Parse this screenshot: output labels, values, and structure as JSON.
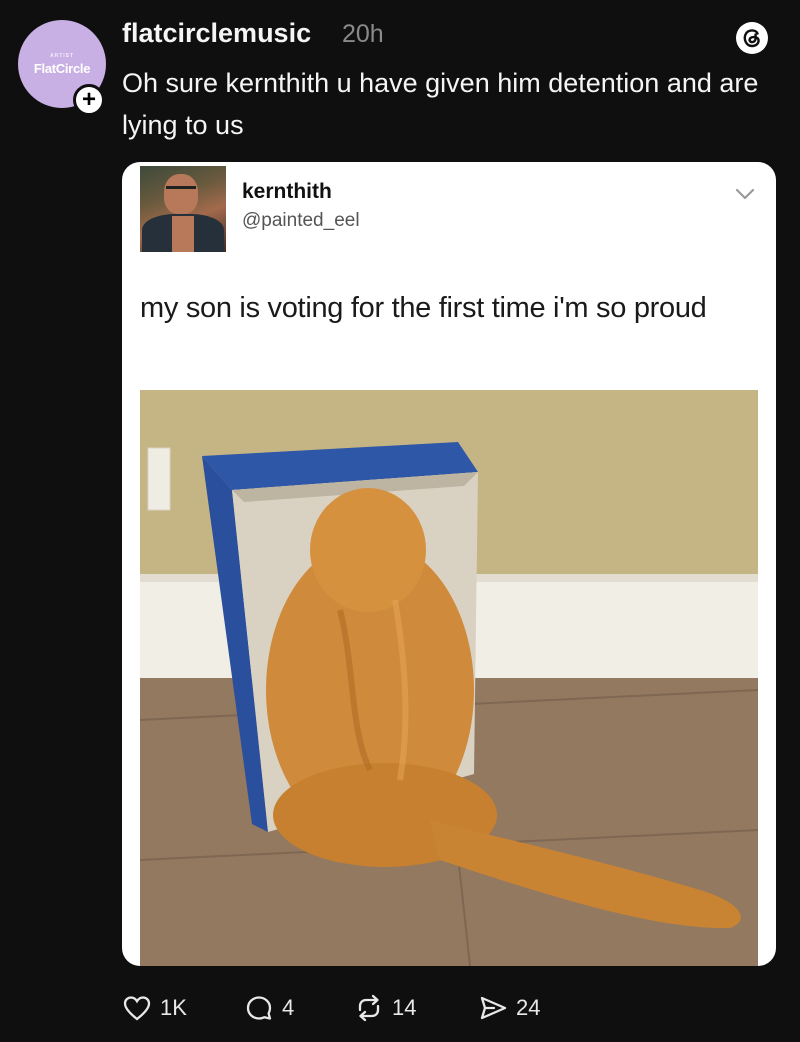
{
  "post": {
    "avatar": {
      "top_text": "ARTIST",
      "brand_text": "FlatCircle"
    },
    "follow_symbol": "+",
    "username": "flatcirclemusic",
    "timestamp": "20h",
    "text": "Oh sure kernthith u have given him detention and are lying to us"
  },
  "embedded_tweet": {
    "display_name": "kernthith",
    "handle": "@painted_eel",
    "text": "my son is voting for the first time i'm so proud"
  },
  "actions": {
    "likes": "1K",
    "replies": "4",
    "reposts": "14",
    "shares": "24"
  },
  "icons": [
    "threads-logo-icon",
    "plus-icon",
    "chevron-down-icon",
    "heart-icon",
    "comment-icon",
    "repost-icon",
    "share-icon"
  ],
  "colors": {
    "background": "#0f0f10",
    "avatar": "#c9b0e4",
    "card": "#ffffff",
    "muted": "#8a8a8a"
  }
}
